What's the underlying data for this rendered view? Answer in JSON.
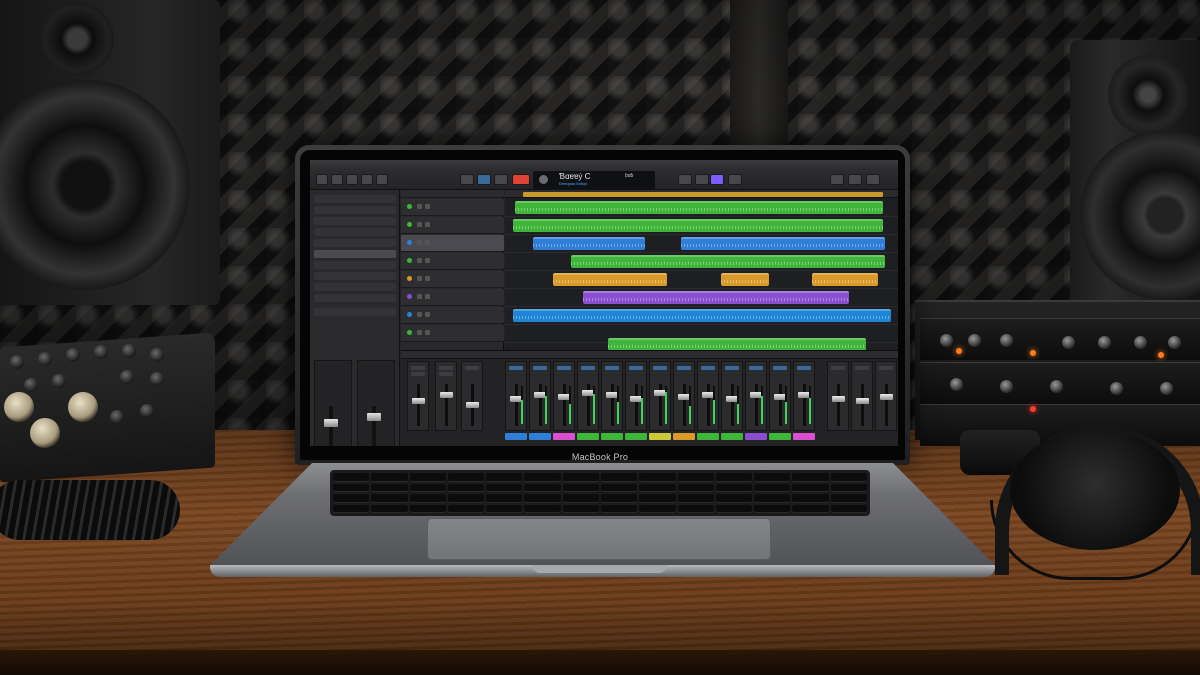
{
  "laptop": {
    "brand_label": "MacBook Pro"
  },
  "daw": {
    "lcd_title": "Ɓɑɐɐẏ C",
    "lcd_subtitle": "Ɖeeɑɲɑɑ ɓɑɓɑɲ",
    "lcd_mode": "ɓɑɓ"
  },
  "colors": {
    "green": "#3fb53a",
    "blue": "#2f7fd8",
    "orange": "#d99a2a",
    "purple": "#8a4fd0",
    "cyan_blue": "#1f86d6",
    "accent_red": "#e04335",
    "accent_violet": "#7a5cff",
    "desk_wood": "#7a4620"
  }
}
